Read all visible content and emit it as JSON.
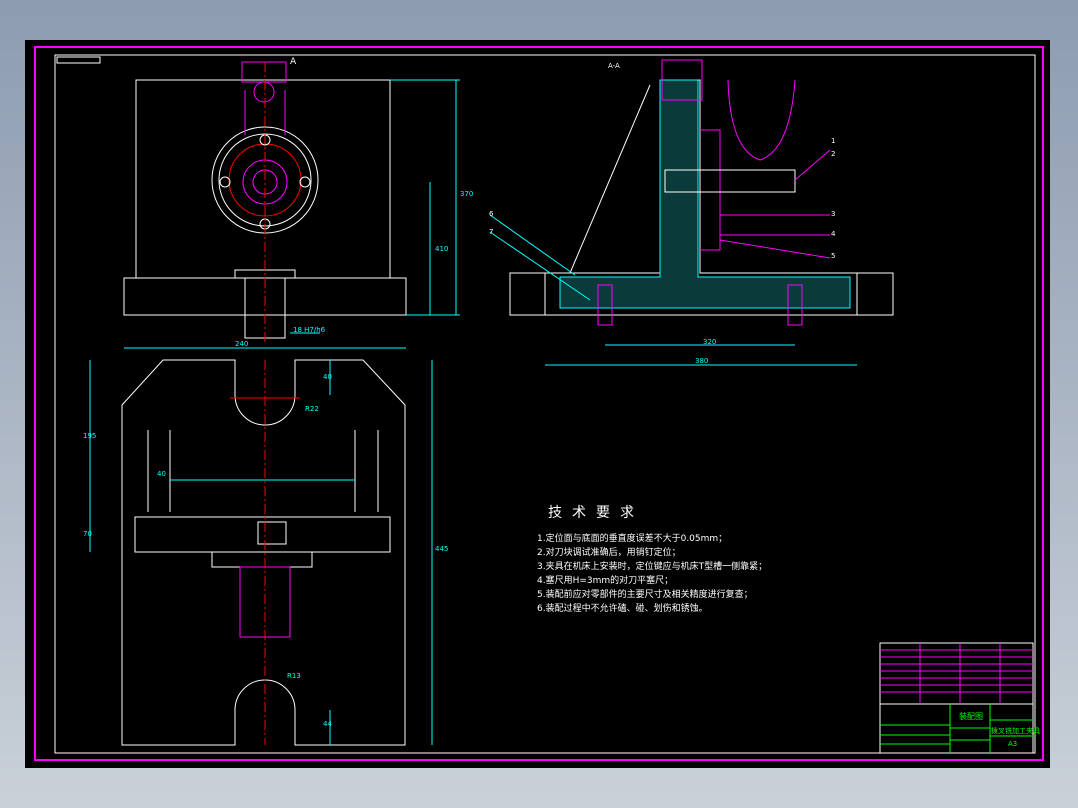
{
  "view_labels": {
    "section_mark": "A",
    "section_view": "A-A"
  },
  "dimensions": {
    "fit": "18",
    "fit_upper": "H7",
    "fit_lower": "h6",
    "d1": "370",
    "d2": "410",
    "d3": "240",
    "d4": "320",
    "d5": "380",
    "d6": "40",
    "d7": "195",
    "d8": "40",
    "d9": "70",
    "d10": "445",
    "d11": "44",
    "d12": "R13",
    "d13": "R22"
  },
  "balloons": [
    "1",
    "2",
    "3",
    "4",
    "5",
    "6",
    "7"
  ],
  "requirements": {
    "title": "技术要求",
    "items": [
      "1.定位面与底面的垂直度误差不大于0.05mm；",
      "2.对刀块调试准确后，用销钉定位；",
      "3.夹具在机床上安装时，定位键应与机床T型槽一侧靠紧；",
      "4.塞尺用H=3mm的对刀平塞尺；",
      "5.装配前应对零部件的主要尺寸及相关精度进行复查；",
      "6.装配过程中不允许磕、碰、划伤和锈蚀。"
    ]
  },
  "title_block": {
    "drawing_name": "装配图",
    "part_name": "拨叉铣加工夹具",
    "sheet": "A3"
  },
  "colors": {
    "frame": "#ff00ff",
    "outline": "#ffffff",
    "dimension": "#00ffff",
    "part": "#ff00ff",
    "title_block": "#00ff00",
    "center": "#ff0000"
  }
}
